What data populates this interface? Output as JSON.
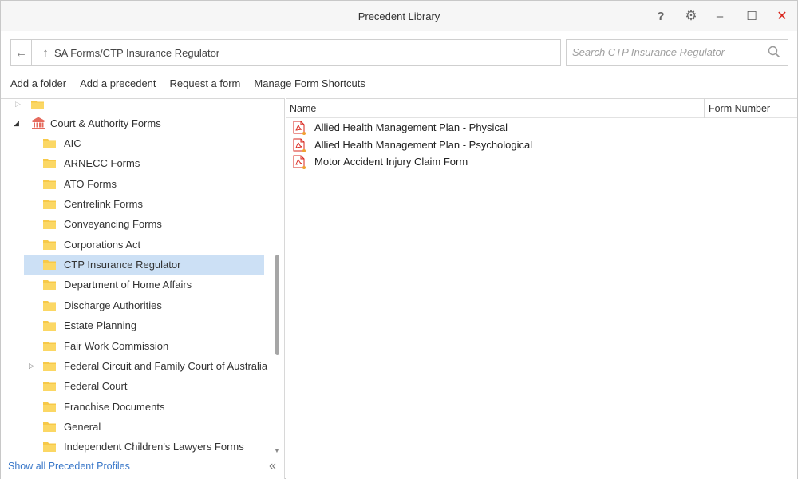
{
  "window": {
    "title": "Precedent Library",
    "help_glyph": "?",
    "settings_glyph": "⚙",
    "minimize_glyph": "–",
    "maximize_glyph": "☐",
    "close_glyph": "✕"
  },
  "address": {
    "path": "SA Forms/CTP Insurance Regulator",
    "back_glyph": "←",
    "up_glyph": "↑"
  },
  "search": {
    "placeholder": "Search CTP Insurance Regulator",
    "value": ""
  },
  "actions": [
    "Add a folder",
    "Add a precedent",
    "Request a form",
    "Manage Form Shortcuts"
  ],
  "tree": {
    "root_label": "Court & Authority Forms",
    "items": [
      {
        "label": "AIC"
      },
      {
        "label": "ARNECC Forms"
      },
      {
        "label": "ATO Forms"
      },
      {
        "label": "Centrelink Forms"
      },
      {
        "label": "Conveyancing Forms"
      },
      {
        "label": "Corporations Act"
      },
      {
        "label": "CTP Insurance Regulator"
      },
      {
        "label": "Department of Home Affairs"
      },
      {
        "label": "Discharge Authorities"
      },
      {
        "label": "Estate Planning"
      },
      {
        "label": "Fair Work Commission"
      },
      {
        "label": "Federal Circuit and Family Court of Australia"
      },
      {
        "label": "Federal Court"
      },
      {
        "label": "Franchise Documents"
      },
      {
        "label": "General"
      },
      {
        "label": "Independent Children's Lawyers Forms"
      }
    ],
    "selected_label": "CTP Insurance Regulator"
  },
  "footer": {
    "show_all": "Show all Precedent Profiles",
    "collapse_glyph": "«"
  },
  "list": {
    "columns": [
      "Name",
      "Form Number"
    ],
    "rows": [
      {
        "name": "Allied Health Management Plan - Physical",
        "form_number": ""
      },
      {
        "name": "Allied Health Management Plan - Psychological",
        "form_number": ""
      },
      {
        "name": "Motor Accident Injury Claim Form",
        "form_number": ""
      }
    ]
  },
  "colors": {
    "selection": "#cce0f5",
    "link": "#3a78c9",
    "close": "#d9261c",
    "folder": "#f7c948",
    "pdf": "#d9261c"
  }
}
